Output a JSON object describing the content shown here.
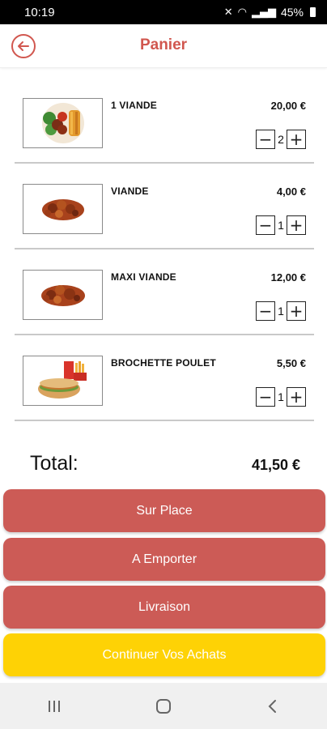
{
  "status_bar": {
    "time": "10:19",
    "battery": "45%"
  },
  "header": {
    "title": "Panier",
    "back_icon": "back-arrow-circle-icon"
  },
  "cart": {
    "items": [
      {
        "name": "1 VIANDE",
        "price": "20,00 €",
        "quantity": "2",
        "image": "plate-meat-vegetables-image"
      },
      {
        "name": "VIANDE",
        "price": "4,00 €",
        "quantity": "1",
        "image": "meat-chunks-image"
      },
      {
        "name": "MAXI VIANDE",
        "price": "12,00 €",
        "quantity": "1",
        "image": "meat-chunks-image"
      },
      {
        "name": "BROCHETTE POULET",
        "price": "5,50 €",
        "quantity": "1",
        "image": "sandwich-fries-drink-image"
      }
    ],
    "minus_symbol": "−",
    "plus_symbol": "+"
  },
  "total": {
    "label": "Total:",
    "value": "41,50 €"
  },
  "actions": {
    "sur_place": "Sur Place",
    "a_emporter": "A Emporter",
    "livraison": "Livraison",
    "continuer": "Continuer Vos Achats"
  },
  "colors": {
    "accent": "#d1574f",
    "button_red": "#cc5b56",
    "button_yellow": "#fed205"
  }
}
